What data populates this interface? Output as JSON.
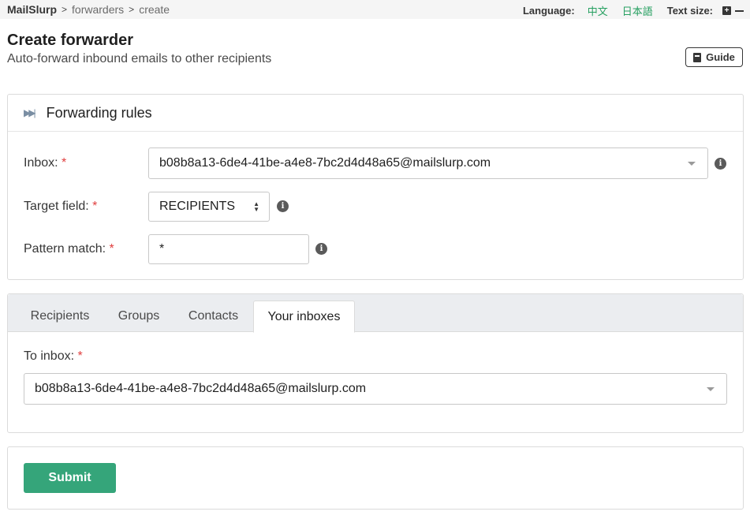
{
  "breadcrumb": {
    "brand": "MailSlurp",
    "items": [
      "forwarders",
      "create"
    ],
    "separator": ">"
  },
  "topbar": {
    "language_label": "Language:",
    "languages": [
      "中文",
      "日本語"
    ],
    "text_size_label": "Text size:",
    "increase_symbol": "+"
  },
  "header": {
    "title": "Create forwarder",
    "subtitle": "Auto-forward inbound emails to other recipients",
    "guide_label": "Guide"
  },
  "rules": {
    "title": "Forwarding rules",
    "inbox_label": "Inbox:",
    "inbox_value": "b08b8a13-6de4-41be-a4e8-7bc2d4d48a65@mailslurp.com",
    "target_label": "Target field:",
    "target_value": "RECIPIENTS",
    "pattern_label": "Pattern match:",
    "pattern_value": "*",
    "required_mark": "*",
    "info_symbol": "i"
  },
  "tabs": {
    "items": [
      "Recipients",
      "Groups",
      "Contacts",
      "Your inboxes"
    ],
    "active": "Your inboxes",
    "to_inbox_label": "To inbox:",
    "to_inbox_value": "b08b8a13-6de4-41be-a4e8-7bc2d4d48a65@mailslurp.com"
  },
  "submit": {
    "label": "Submit"
  },
  "colors": {
    "accent_green": "#35a57a",
    "link_green": "#27a061",
    "required_red": "#e03e3e"
  }
}
